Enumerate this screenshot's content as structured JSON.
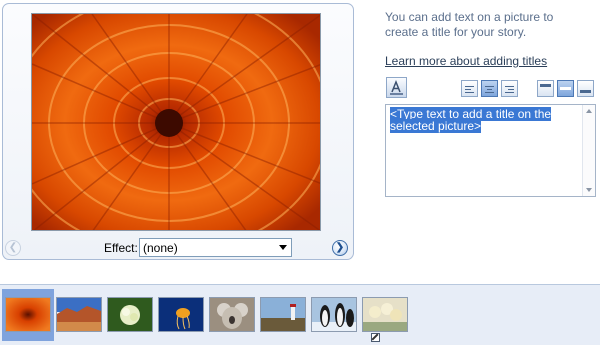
{
  "preview": {
    "image_name": "orange-chrysanthemum",
    "prev_icon": "chevron-left-icon",
    "next_icon": "chevron-right-icon",
    "effect_label": "Effect:",
    "effect_value": "(none)"
  },
  "title_panel": {
    "info_text": "You can add text on a picture to create a title for your story.",
    "learn_more_link": "Learn more about adding titles",
    "font_button_icon": "font-color-icon",
    "align_buttons": [
      "align-left-icon",
      "align-center-icon",
      "align-right-icon"
    ],
    "position_buttons": [
      "position-top-icon",
      "position-middle-icon",
      "position-bottom-icon"
    ],
    "selected_position": "middle",
    "text_area_value": "<Type text to add a title on the selected picture>"
  },
  "filmstrip": {
    "selected_index": 0,
    "thumbnails": [
      "chrysanthemum",
      "desert",
      "hydrangeas",
      "jellyfish",
      "koala",
      "lighthouse",
      "penguins",
      "tulips"
    ]
  },
  "colors": {
    "selection": "#3a78d4",
    "filmstrip_bg": "#e7edf7",
    "frame_border": "#a9bbd6"
  }
}
